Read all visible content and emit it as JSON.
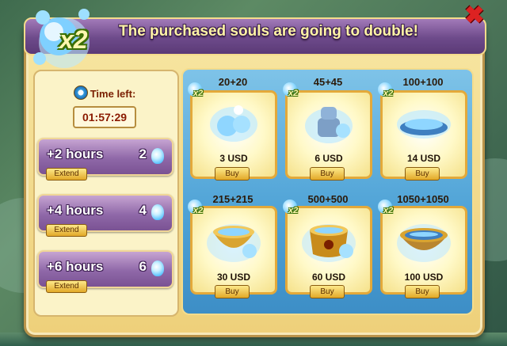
{
  "title": "The purchased souls are going to double!",
  "emblem_text": "x2",
  "close_glyph": "✖",
  "time_left": {
    "label": "Time left:",
    "value": "01:57:29"
  },
  "extensions": [
    {
      "label": "+2 hours",
      "cost": "2",
      "button": "Extend"
    },
    {
      "label": "+4 hours",
      "cost": "4",
      "button": "Extend"
    },
    {
      "label": "+6 hours",
      "cost": "6",
      "button": "Extend"
    }
  ],
  "badge_text": "x2",
  "packs": [
    {
      "amount": "20+20",
      "price": "3 USD",
      "button": "Buy",
      "icon": "soul-bottles-icon"
    },
    {
      "amount": "45+45",
      "price": "6 USD",
      "button": "Buy",
      "icon": "soul-jar-stack-icon"
    },
    {
      "amount": "100+100",
      "price": "14 USD",
      "button": "Buy",
      "icon": "soul-plate-icon"
    },
    {
      "amount": "215+215",
      "price": "30 USD",
      "button": "Buy",
      "icon": "soul-gold-pot-icon"
    },
    {
      "amount": "500+500",
      "price": "60 USD",
      "button": "Buy",
      "icon": "soul-gold-cauldron-icon"
    },
    {
      "amount": "1050+1050",
      "price": "100 USD",
      "button": "Buy",
      "icon": "soul-bowl-icon"
    }
  ],
  "colors": {
    "header": "#6d4a8a",
    "panel_blue": "#4ea2d6",
    "dialog": "#eed07a",
    "button": "#e2a928",
    "close": "#d22222"
  }
}
